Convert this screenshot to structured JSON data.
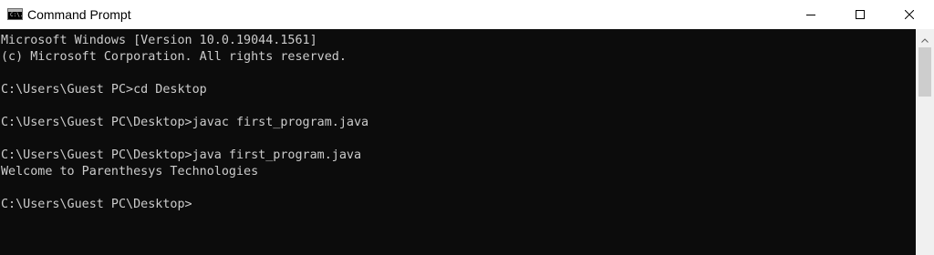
{
  "window": {
    "title": "Command Prompt",
    "icon": "cmd-app-icon",
    "icon_glyph": "C:\\.",
    "controls": {
      "minimize_icon": "minimize-icon",
      "maximize_icon": "maximize-icon",
      "close_icon": "close-icon"
    }
  },
  "console": {
    "background": "#0c0c0c",
    "foreground": "#cccccc",
    "lines": [
      "Microsoft Windows [Version 10.0.19044.1561]",
      "(c) Microsoft Corporation. All rights reserved.",
      "",
      "C:\\Users\\Guest PC>cd Desktop",
      "",
      "C:\\Users\\Guest PC\\Desktop>javac first_program.java",
      "",
      "C:\\Users\\Guest PC\\Desktop>java first_program.java",
      "Welcome to Parenthesys Technologies",
      "",
      "C:\\Users\\Guest PC\\Desktop>"
    ]
  },
  "scrollbar": {
    "up_arrow_icon": "scroll-up-arrow-icon"
  }
}
